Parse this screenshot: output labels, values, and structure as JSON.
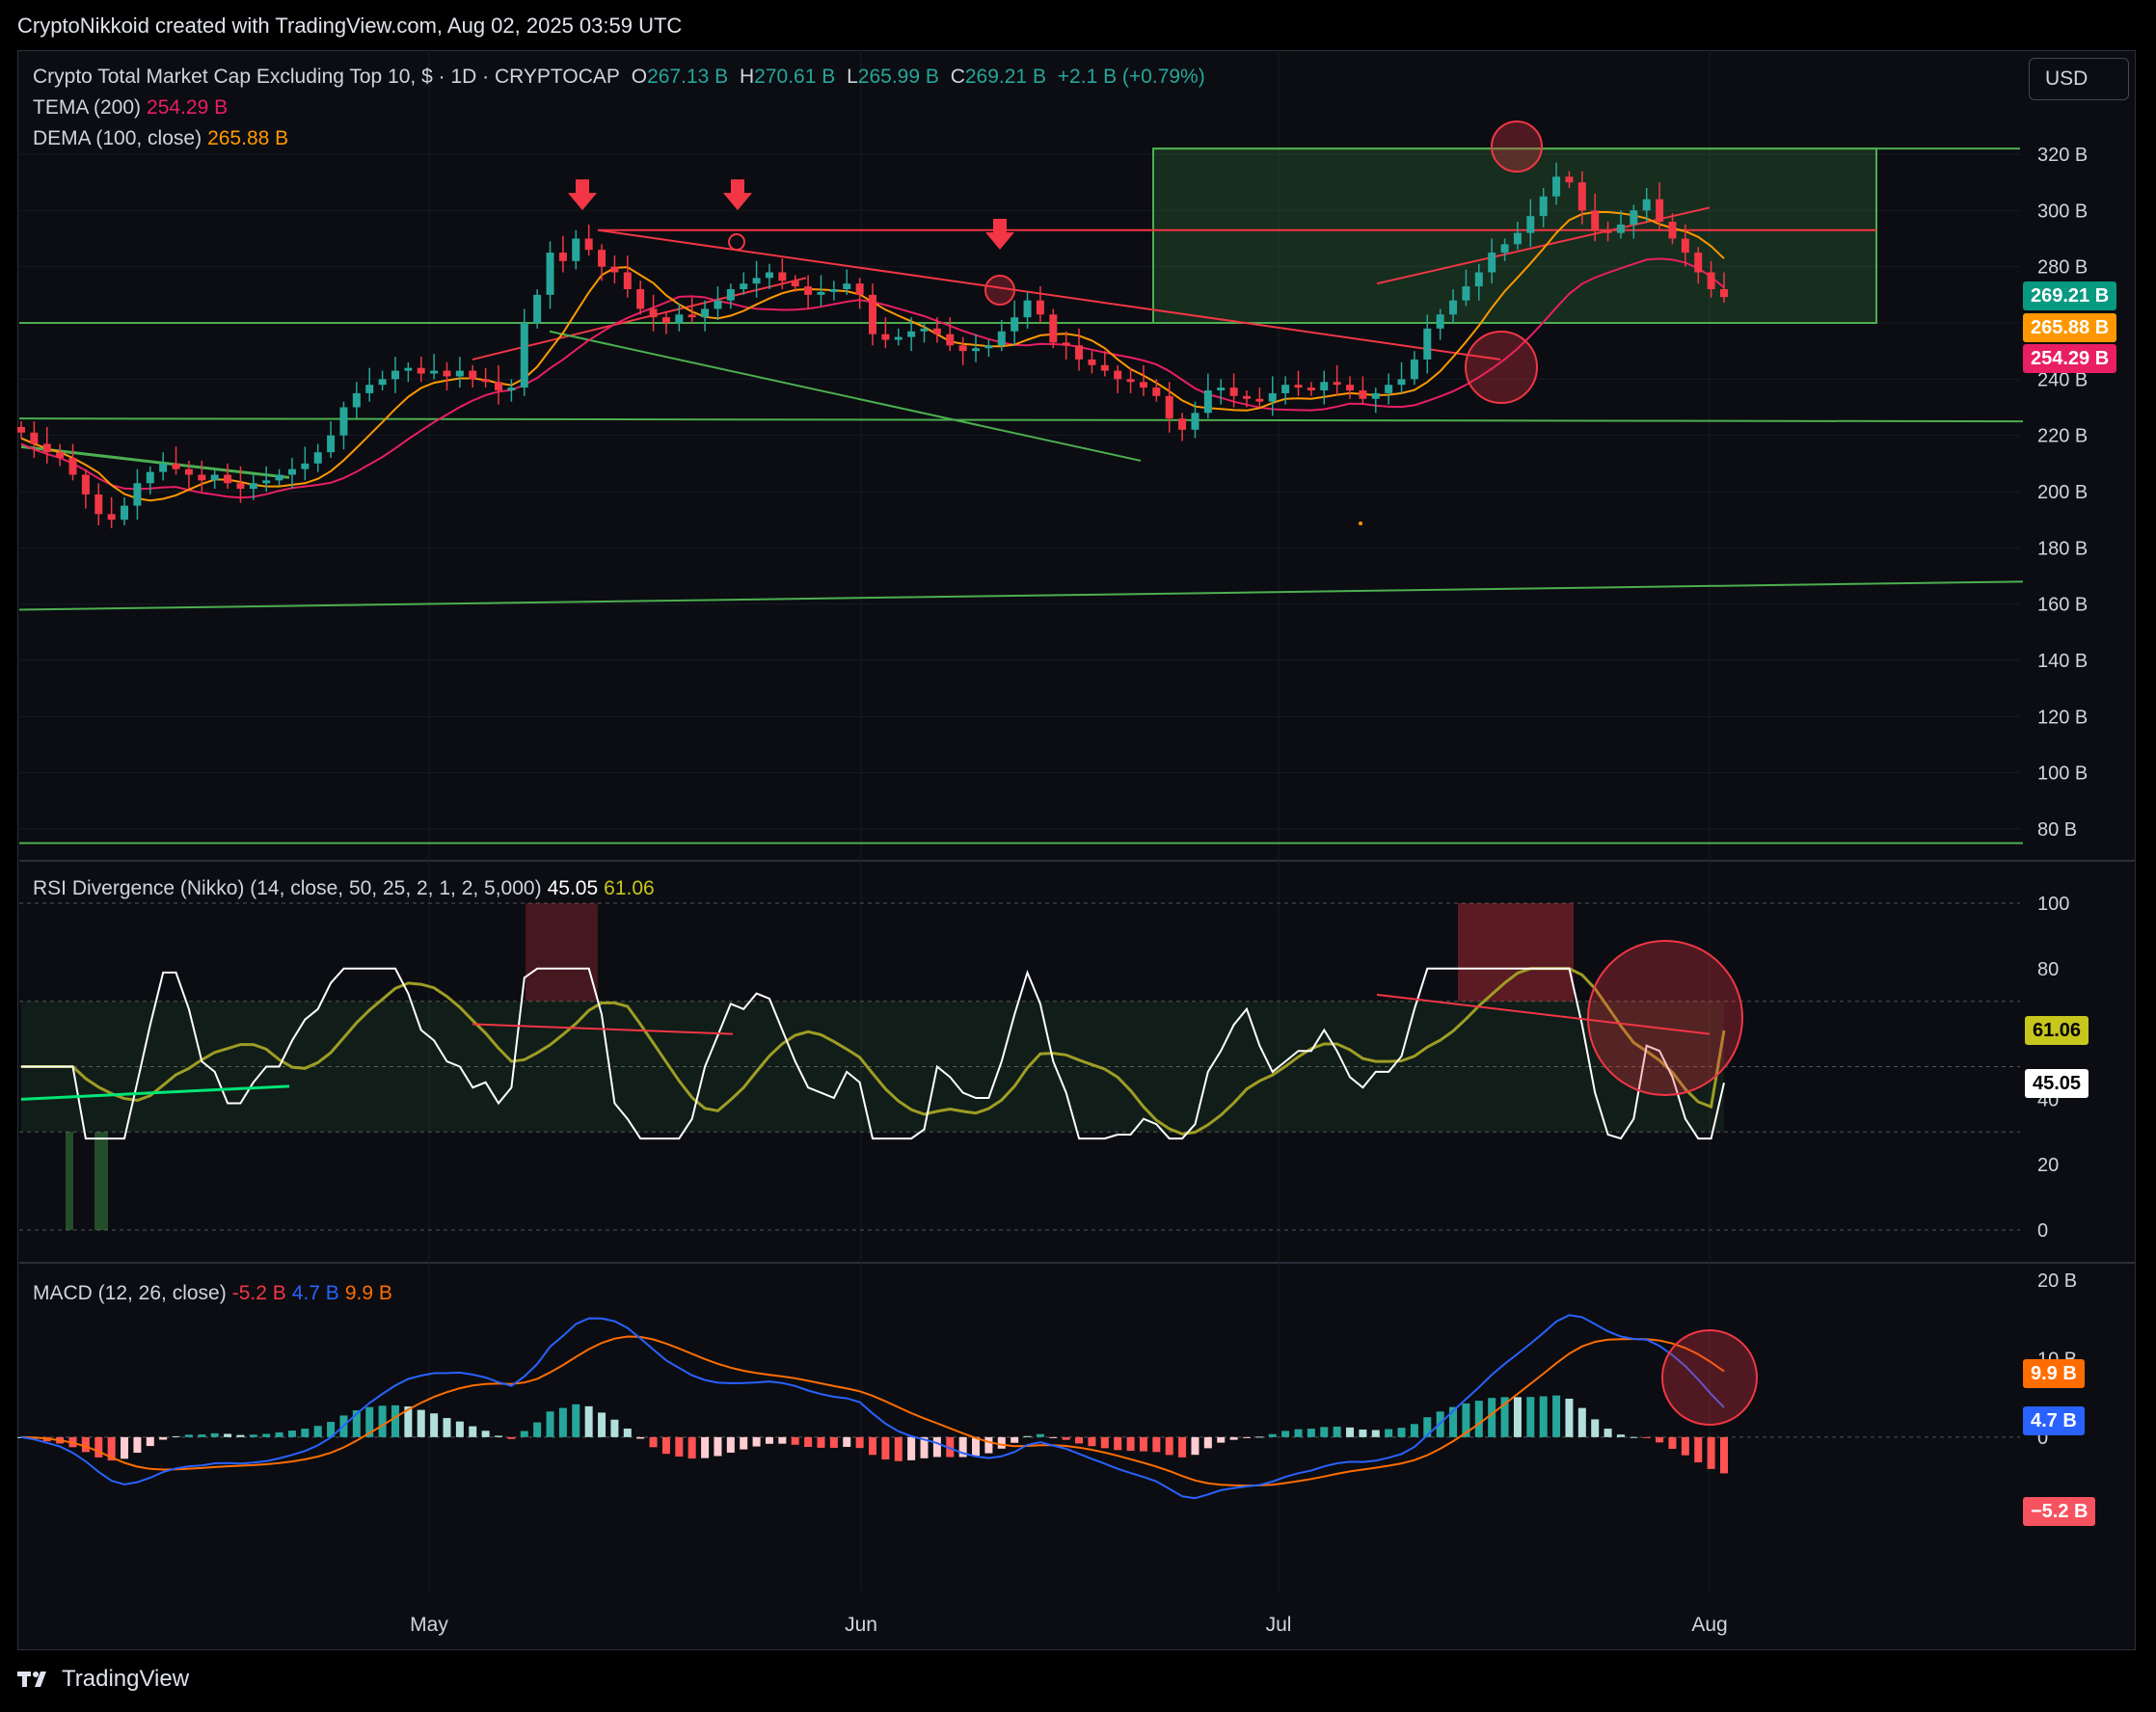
{
  "header": "CryptoNikkoid created with TradingView.com, Aug 02, 2025 03:59 UTC",
  "brand": "TradingView",
  "currency_button": "USD",
  "colors": {
    "bg": "#0b0d12",
    "grid": "#1f2229",
    "up": "#26a69a",
    "down": "#f23645",
    "tema": "#e91e63",
    "dema": "#ff9800",
    "trend_green": "#4caf50",
    "trend_red": "#f23645",
    "rsi": "#ffffff",
    "rsi_ma": "#9e9d24",
    "macd": "#2962ff",
    "signal": "#ff6d00"
  },
  "main_legend": {
    "title": "Crypto Total Market Cap Excluding Top 10, $ · 1D · CRYPTOCAP",
    "o_label": "O",
    "o": "267.13 B",
    "h_label": "H",
    "h": "270.61 B",
    "l_label": "L",
    "l": "265.99 B",
    "c_label": "C",
    "c": "269.21 B",
    "change": "+2.1 B (+0.79%)",
    "tema_label": "TEMA (200)",
    "tema": "254.29 B",
    "dema_label": "DEMA (100, close)",
    "dema": "265.88 B"
  },
  "rsi_legend": {
    "label": "RSI Divergence (Nikko) (14, close, 50, 25, 2, 1, 2, 5,000)",
    "v1": "45.05",
    "v2": "61.06"
  },
  "macd_legend": {
    "label": "MACD (12, 26, close)",
    "macd_hist": "-5.2 B",
    "macd": "4.7 B",
    "signal": "9.9 B"
  },
  "price_tags": {
    "close": "269.21 B",
    "dema": "265.88 B",
    "tema": "254.29 B"
  },
  "rsi_tags": {
    "ma": "61.06",
    "rsi": "45.05"
  },
  "macd_tags": {
    "signal": "9.9 B",
    "macd": "4.7 B",
    "hist": "−5.2 B"
  },
  "price_axis": [
    "320 B",
    "300 B",
    "280 B",
    "260 B",
    "240 B",
    "220 B",
    "200 B",
    "180 B",
    "160 B",
    "140 B",
    "120 B",
    "100 B",
    "80 B"
  ],
  "rsi_axis": [
    "100",
    "80",
    "60",
    "40",
    "20",
    "0"
  ],
  "macd_axis": [
    "20 B",
    "10 B",
    "0",
    "−10 B"
  ],
  "time_axis": [
    "May",
    "Jun",
    "Jul",
    "Aug"
  ],
  "chart_data": [
    {
      "type": "candlestick",
      "title": "Crypto Total Market Cap Excluding Top 10, $ · 1D · CRYPTOCAP",
      "ylim": [
        70,
        330
      ],
      "x_range": [
        "2025-04-03",
        "2025-08-02"
      ],
      "close_series_B": [
        221,
        217,
        214,
        212,
        206,
        199,
        192,
        190,
        195,
        203,
        207,
        210,
        208,
        206,
        204,
        206,
        203,
        201,
        203,
        204,
        206,
        208,
        210,
        214,
        220,
        230,
        235,
        238,
        240,
        243,
        244,
        242,
        243,
        241,
        243,
        240,
        239,
        236,
        237,
        260,
        270,
        285,
        282,
        290,
        286,
        280,
        278,
        272,
        265,
        262,
        260,
        263,
        262,
        265,
        268,
        272,
        274,
        276,
        278,
        275,
        273,
        270,
        271,
        272,
        274,
        270,
        256,
        254,
        255,
        257,
        258,
        256,
        252,
        250,
        251,
        252,
        257,
        262,
        268,
        263,
        253,
        252,
        247,
        245,
        243,
        240,
        239,
        237,
        234,
        226,
        222,
        228,
        236,
        237,
        234,
        233,
        232,
        235,
        238,
        237,
        236,
        239,
        238,
        236,
        233,
        235,
        238,
        240,
        247,
        258,
        263,
        268,
        273,
        278,
        285,
        288,
        292,
        298,
        305,
        312,
        310,
        300,
        293,
        292,
        295,
        300,
        304,
        296,
        290,
        285,
        278,
        272,
        269.21
      ],
      "tema_200_B": 254.29,
      "dema_100_B": 265.88,
      "horizontal_levels_B": [
        293,
        260,
        226
      ],
      "range_box_B": [
        260,
        322
      ]
    },
    {
      "type": "line",
      "title": "RSI Divergence (Nikko)",
      "ylim": [
        0,
        100
      ],
      "series": [
        {
          "name": "RSI",
          "last": 45.05
        },
        {
          "name": "RSI MA",
          "last": 61.06
        }
      ],
      "reference_lines": [
        100,
        70,
        50,
        30,
        0
      ]
    },
    {
      "type": "line",
      "title": "MACD (12, 26, close)",
      "ylim": [
        -15,
        20
      ],
      "series": [
        {
          "name": "MACD",
          "last": 4.7
        },
        {
          "name": "Signal",
          "last": 9.9
        },
        {
          "name": "Histogram",
          "last": -5.2
        }
      ]
    }
  ]
}
